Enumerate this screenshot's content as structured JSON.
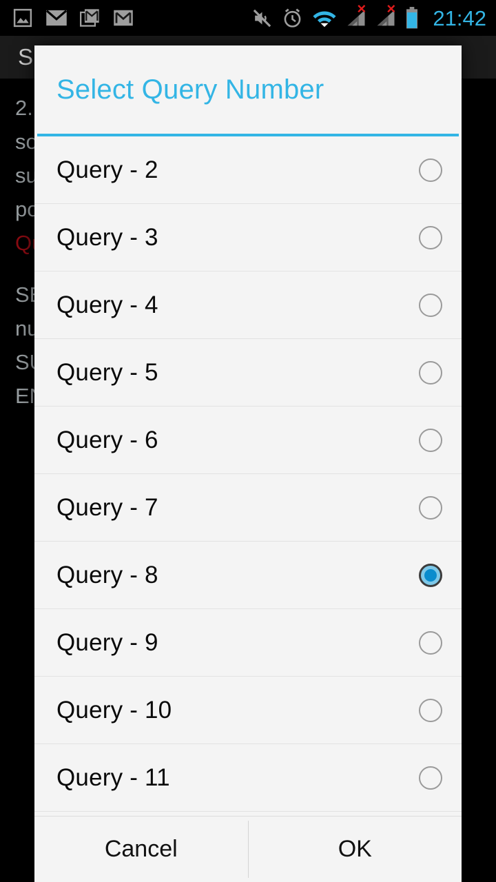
{
  "status_bar": {
    "icons_left": [
      "image-icon",
      "mail-icon",
      "gmail-stack-icon",
      "gmail-icon"
    ],
    "icons_right": [
      "mute-icon",
      "alarm-icon",
      "wifi-icon",
      "signal-no-sim-1-icon",
      "signal-no-sim-2-icon",
      "battery-icon"
    ],
    "time": "21:42",
    "time_color": "#33b5e5"
  },
  "background_app": {
    "action_bar_title": "S",
    "lines": [
      "2.",
      "so",
      "su",
      "po"
    ],
    "red_line": "Qu",
    "code_lines": [
      "SE",
      "nu",
      "SU",
      "EN"
    ],
    "right_fragment": "0"
  },
  "dialog": {
    "title": "Select Query Number",
    "accent_color": "#33b5e5",
    "selected_value": "Query - 8",
    "items": [
      {
        "label": "Query - 2",
        "selected": false
      },
      {
        "label": "Query - 3",
        "selected": false
      },
      {
        "label": "Query - 4",
        "selected": false
      },
      {
        "label": "Query - 5",
        "selected": false
      },
      {
        "label": "Query - 6",
        "selected": false
      },
      {
        "label": "Query - 7",
        "selected": false
      },
      {
        "label": "Query - 8",
        "selected": true
      },
      {
        "label": "Query - 9",
        "selected": false
      },
      {
        "label": "Query - 10",
        "selected": false
      },
      {
        "label": "Query - 11",
        "selected": false
      }
    ],
    "cancel_label": "Cancel",
    "ok_label": "OK"
  }
}
